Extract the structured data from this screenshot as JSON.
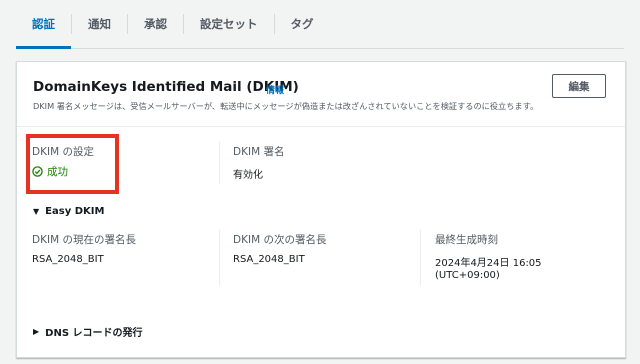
{
  "tabs": [
    {
      "label": "認証",
      "active": true
    },
    {
      "label": "通知",
      "active": false
    },
    {
      "label": "承認",
      "active": false
    },
    {
      "label": "設定セット",
      "active": false
    },
    {
      "label": "タグ",
      "active": false
    }
  ],
  "card": {
    "title": "DomainKeys Identified Mail (DKIM)",
    "info_link": "情報",
    "description": "DKIM 署名メッセージは、受信メールサーバーが、転送中にメッセージが偽造または改ざんされていないことを検証するのに役立ちます。",
    "edit_label": "編集"
  },
  "dkim_config": {
    "label": "DKIM の設定",
    "status": "成功"
  },
  "dkim_signature": {
    "label": "DKIM 署名",
    "value": "有効化"
  },
  "easy_dkim": {
    "heading": "Easy DKIM",
    "current_key_length": {
      "label": "DKIM の現在の署名長",
      "value": "RSA_2048_BIT"
    },
    "next_key_length": {
      "label": "DKIM の次の署名長",
      "value": "RSA_2048_BIT"
    },
    "last_generated": {
      "label": "最終生成時刻",
      "value_line1": "2024年4月24日 16:05",
      "value_line2": "(UTC+09:00)"
    }
  },
  "dns_section": {
    "heading": "DNS レコードの発行"
  },
  "colors": {
    "accent": "#0073bb",
    "success": "#1d8102",
    "highlight": "#e53222"
  }
}
